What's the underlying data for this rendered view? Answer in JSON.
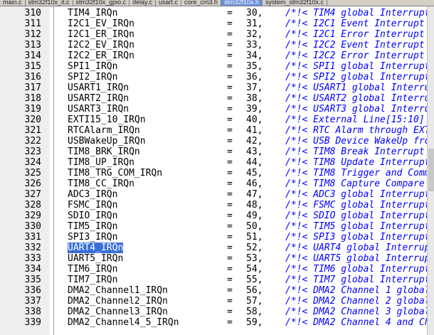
{
  "tabs": [
    {
      "label": "main.c"
    },
    {
      "label": "stm32f10x_it.c"
    },
    {
      "label": "stm32f10x_gpio.c"
    },
    {
      "label": "delay.c"
    },
    {
      "label": "usart.c"
    },
    {
      "label": "core_cm3.h"
    },
    {
      "label": "stm32f10x.h"
    },
    {
      "label": "system_stm32f10x.c"
    }
  ],
  "active_tab": 6,
  "editor": {
    "selected_line": 332,
    "lines": [
      {
        "ln": "310",
        "name": "TIM4_IRQn",
        "eq": "=",
        "num": "30,",
        "comment": "/*!< TIM4 global Interrupt"
      },
      {
        "ln": "311",
        "name": "I2C1_EV_IRQn",
        "eq": "=",
        "num": "31,",
        "comment": "/*!< I2C1 Event Interrupt"
      },
      {
        "ln": "312",
        "name": "I2C1_ER_IRQn",
        "eq": "=",
        "num": "32,",
        "comment": "/*!< I2C1 Error Interrupt"
      },
      {
        "ln": "313",
        "name": "I2C2_EV_IRQn",
        "eq": "=",
        "num": "33,",
        "comment": "/*!< I2C2 Event Interrupt"
      },
      {
        "ln": "314",
        "name": "I2C2_ER_IRQn",
        "eq": "=",
        "num": "34,",
        "comment": "/*!< I2C2 Error Interrupt"
      },
      {
        "ln": "315",
        "name": "SPI1_IRQn",
        "eq": "=",
        "num": "35,",
        "comment": "/*!< SPI1 global Interrupt"
      },
      {
        "ln": "316",
        "name": "SPI2_IRQn",
        "eq": "=",
        "num": "36,",
        "comment": "/*!< SPI2 global Interrupt"
      },
      {
        "ln": "317",
        "name": "USART1_IRQn",
        "eq": "=",
        "num": "37,",
        "comment": "/*!< USART1 global Interrup"
      },
      {
        "ln": "318",
        "name": "USART2_IRQn",
        "eq": "=",
        "num": "38,",
        "comment": "/*!< USART2 global Interrup"
      },
      {
        "ln": "319",
        "name": "USART3_IRQn",
        "eq": "=",
        "num": "39,",
        "comment": "/*!< USART3 global Interrup"
      },
      {
        "ln": "320",
        "name": "EXTI15_10_IRQn",
        "eq": "=",
        "num": "40,",
        "comment": "/*!< External Line[15:10]"
      },
      {
        "ln": "321",
        "name": "RTCAlarm_IRQn",
        "eq": "=",
        "num": "41,",
        "comment": "/*!< RTC Alarm through EXT"
      },
      {
        "ln": "322",
        "name": "USBWakeUp_IRQn",
        "eq": "=",
        "num": "42,",
        "comment": "/*!< USB Device WakeUp fro"
      },
      {
        "ln": "323",
        "name": "TIM8_BRK_IRQn",
        "eq": "=",
        "num": "43,",
        "comment": "/*!< TIM8 Break Interrupt"
      },
      {
        "ln": "324",
        "name": "TIM8_UP_IRQn",
        "eq": "=",
        "num": "44,",
        "comment": "/*!< TIM8 Update Interrupt"
      },
      {
        "ln": "325",
        "name": "TIM8_TRG_COM_IRQn",
        "eq": "=",
        "num": "45,",
        "comment": "/*!< TIM8 Trigger and Comm"
      },
      {
        "ln": "326",
        "name": "TIM8_CC_IRQn",
        "eq": "=",
        "num": "46,",
        "comment": "/*!< TIM8 Capture Compare"
      },
      {
        "ln": "327",
        "name": "ADC3_IRQn",
        "eq": "=",
        "num": "47,",
        "comment": "/*!< ADC3 global Interrupt"
      },
      {
        "ln": "328",
        "name": "FSMC_IRQn",
        "eq": "=",
        "num": "48,",
        "comment": "/*!< FSMC global Interrupt"
      },
      {
        "ln": "329",
        "name": "SDIO_IRQn",
        "eq": "=",
        "num": "49,",
        "comment": "/*!< SDIO global Interrupt"
      },
      {
        "ln": "330",
        "name": "TIM5_IRQn",
        "eq": "=",
        "num": "50,",
        "comment": "/*!< TIM5 global Interrupt"
      },
      {
        "ln": "331",
        "name": "SPI3_IRQn",
        "eq": "=",
        "num": "51,",
        "comment": "/*!< SPI3 global Interrupt"
      },
      {
        "ln": "332",
        "name": "UART4_IRQn",
        "eq": "=",
        "num": "52,",
        "comment": "/*!< UART4 global Interrup"
      },
      {
        "ln": "333",
        "name": "UART5_IRQn",
        "eq": "=",
        "num": "53,",
        "comment": "/*!< UART5 global Interrup"
      },
      {
        "ln": "334",
        "name": "TIM6_IRQn",
        "eq": "=",
        "num": "54,",
        "comment": "/*!< TIM6 global Interrupt"
      },
      {
        "ln": "335",
        "name": "TIM7_IRQn",
        "eq": "=",
        "num": "55,",
        "comment": "/*!< TIM7 global Interrupt"
      },
      {
        "ln": "336",
        "name": "DMA2_Channel1_IRQn",
        "eq": "=",
        "num": "56,",
        "comment": "/*!< DMA2 Channel 1 global"
      },
      {
        "ln": "337",
        "name": "DMA2_Channel2_IRQn",
        "eq": "=",
        "num": "57,",
        "comment": "/*!< DMA2 Channel 2 global"
      },
      {
        "ln": "338",
        "name": "DMA2_Channel3_IRQn",
        "eq": "=",
        "num": "58,",
        "comment": "/*!< DMA2 Channel 3 global"
      },
      {
        "ln": "339",
        "name": "DMA2_Channel4_5_IRQn",
        "eq": "=",
        "num": "59,",
        "comment": "/*!< DMA2 Channel 4 and Ch"
      }
    ]
  },
  "colors": {
    "comment": "#0000ff",
    "selection": "#3a6fd8",
    "gutter": "#eeeeee"
  }
}
